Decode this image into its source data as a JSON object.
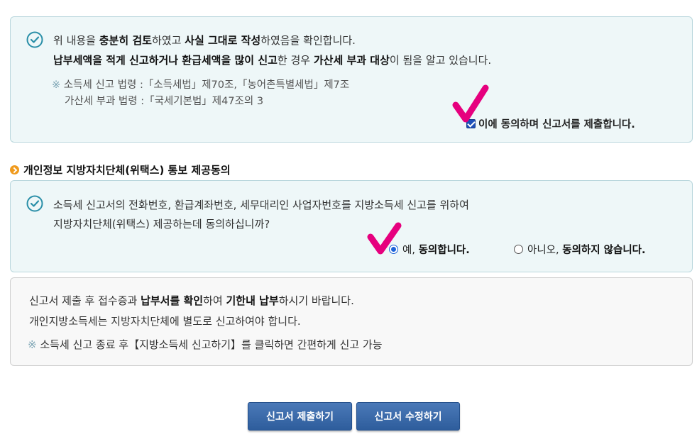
{
  "confirm_box": {
    "line1_a": "위 내용을 ",
    "line1_b": "충분히 검토",
    "line1_c": "하였고 ",
    "line1_d": "사실 그대로 작성",
    "line1_e": "하였음을 확인합니다.",
    "line2_a": "납부세액을 적게 신고하거나 환급세액을 많이 신고",
    "line2_b": "한 경우 ",
    "line2_c": "가산세 부과 대상",
    "line2_d": "이 됨을 알고 있습니다.",
    "note_mark": "※",
    "law1": "소득세 신고 법령 :「소득세법」제70조,「농어촌특별세법」제7조",
    "law2": "가산세 부과 법령 :「국세기본법」제47조의 3",
    "agree_label": "이에 동의하며 신고서를 제출합니다.",
    "agree_checked": true
  },
  "section": {
    "title": "개인정보 지방자치단체(위택스) 통보 제공동의"
  },
  "consent_box": {
    "line1": "소득세 신고서의 전화번호, 환급계좌번호, 세무대리인 사업자번호를 지방소득세 신고를 위하여",
    "line2": "지방자치단체(위택스) 제공하는데 동의하십니까?",
    "yes_a": "예, ",
    "yes_b": "동의합니다.",
    "no_a": "아니오, ",
    "no_b": "동의하지 않습니다.",
    "selected": "yes"
  },
  "info_box": {
    "line1_a": "신고서 제출 후 접수증과 ",
    "line1_b": "납부서를 확인",
    "line1_c": "하여 ",
    "line1_d": "기한내 납부",
    "line1_e": "하시기 바랍니다.",
    "line2": "개인지방소득세는 지방자치단체에 별도로 신고하여야 합니다.",
    "note_mark": "※",
    "line3": "소득세 신고 종료 후【지방소득세 신고하기】를 클릭하면 간편하게 신고 가능"
  },
  "buttons": {
    "submit": "신고서 제출하기",
    "edit": "신고서 수정하기"
  },
  "colors": {
    "accent": "#2e5d9c",
    "annotation_mark": "#e6007e",
    "bullet": "#f09a1c"
  }
}
